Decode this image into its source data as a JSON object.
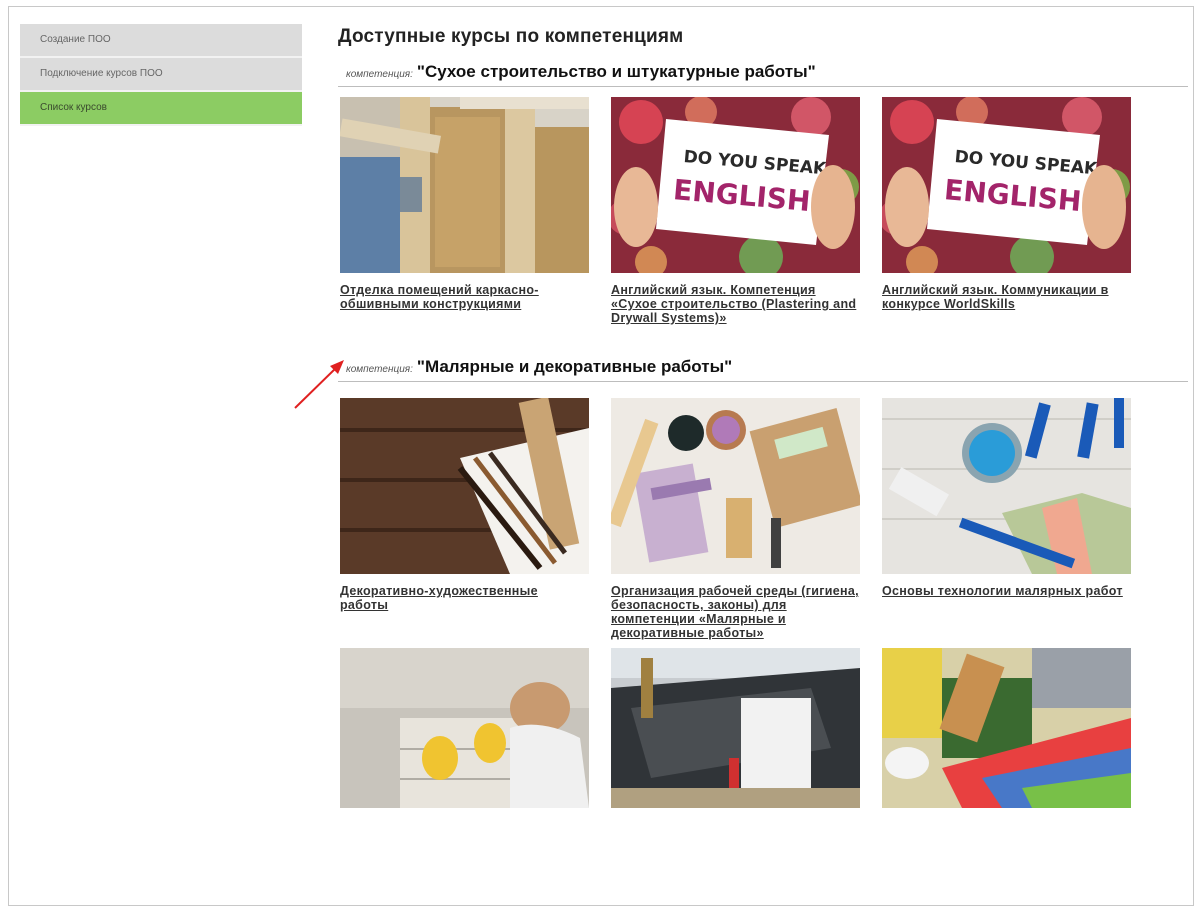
{
  "sidebar": {
    "items": [
      {
        "label": "Создание ПОО"
      },
      {
        "label": "Подключение курсов ПОО"
      },
      {
        "label": "Список курсов"
      }
    ]
  },
  "main": {
    "title": "Доступные курсы по компетенциям",
    "competency_prefix": "компетенция:",
    "competencies": [
      {
        "name": "\"Сухое строительство и штукатурные работы\"",
        "courses": [
          {
            "title": "Отделка помещений каркасно-обшивными конструкциями",
            "image": "wood-frame-construction-photo"
          },
          {
            "title": "Английский язык. Компетенция «Сухое строительство (Plastering and Drywall Systems)»",
            "image": "do-you-speak-english-sign-photo"
          },
          {
            "title": "Английский язык. Коммуникации в конкурсе WorldSkills",
            "image": "do-you-speak-english-sign-photo"
          }
        ]
      },
      {
        "name": "\"Малярные и декоративные работы\"",
        "courses": [
          {
            "title": "Декоративно-художественные работы",
            "image": "paint-brushes-on-wood-photo"
          },
          {
            "title": "Организация рабочей среды (гигиена, безопасность, законы) для компетенции «Малярные и декоративные работы»",
            "image": "painting-tools-flatlay-photo"
          },
          {
            "title": "Основы технологии малярных работ",
            "image": "paint-roller-and-brushes-photo"
          },
          {
            "title": "",
            "image": "worker-laying-tiles-photo"
          },
          {
            "title": "",
            "image": "foundation-construction-photo"
          },
          {
            "title": "",
            "image": "paint-and-color-swatches-photo"
          }
        ]
      }
    ],
    "sign_text": {
      "line1": "DO YOU SPEAK",
      "line2": "ENGLISH?"
    }
  },
  "colors": {
    "sidebar_bg": "#dcdcdc",
    "sidebar_active": "#8ccc63",
    "arrow": "#e02020",
    "sign_accent": "#a3246a"
  }
}
